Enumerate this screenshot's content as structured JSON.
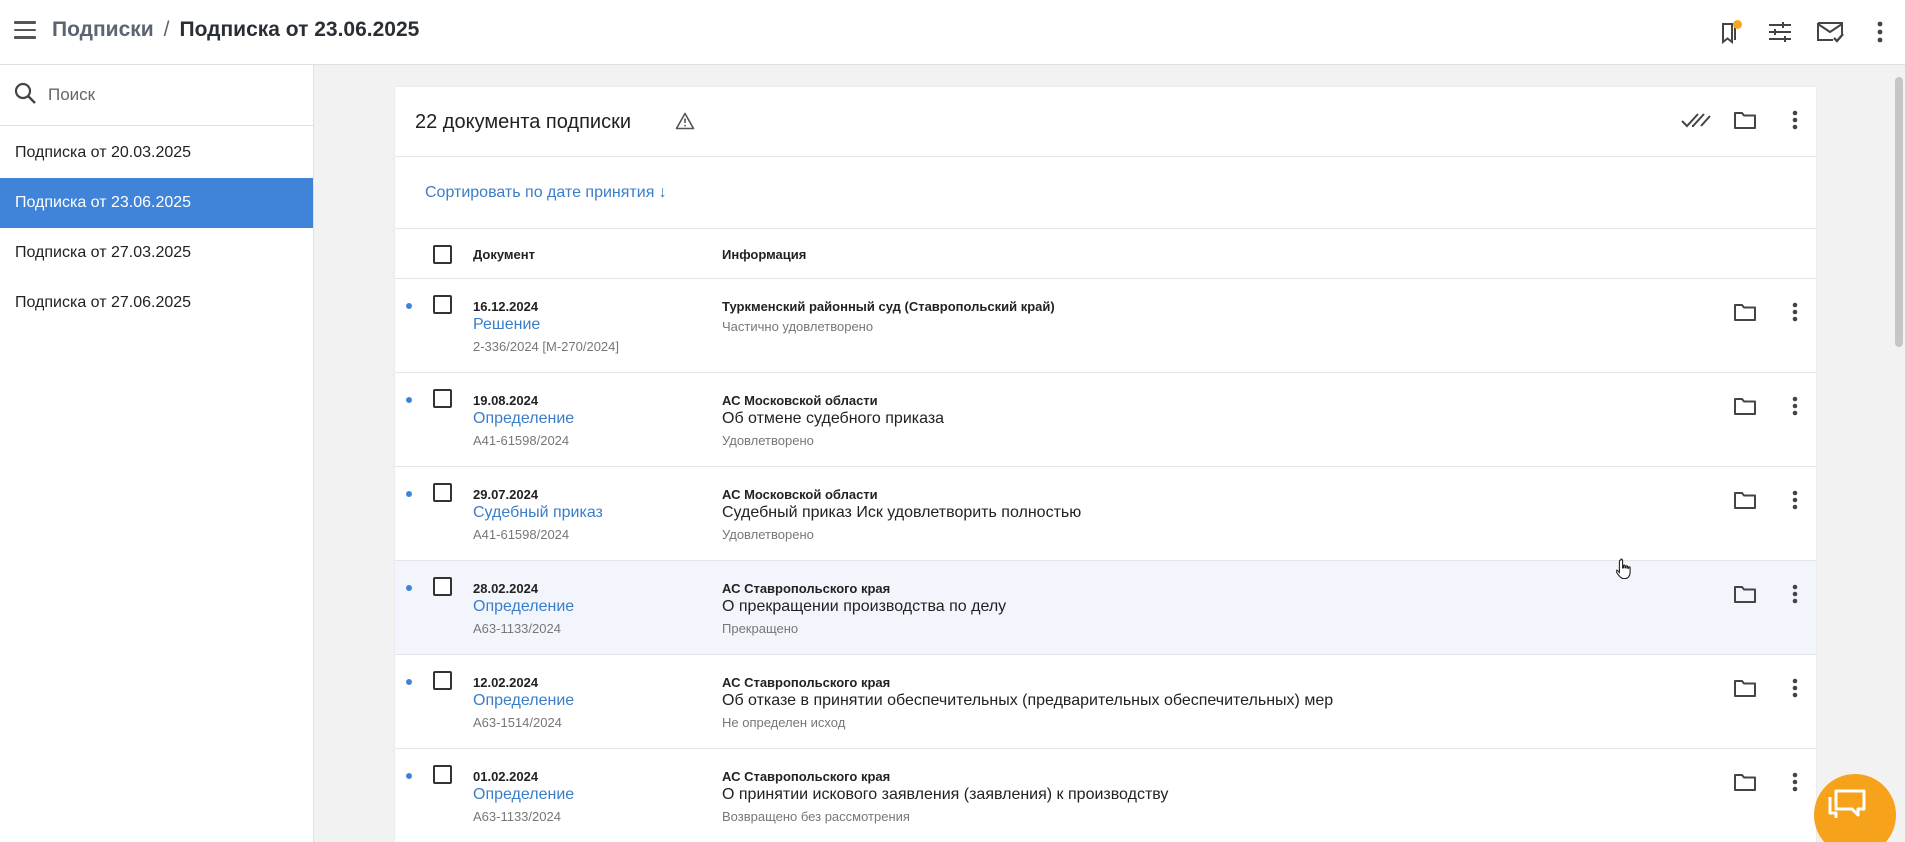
{
  "topbar": {
    "breadcrumb_parent": "Подписки",
    "breadcrumb_separator": "/",
    "breadcrumb_current": "Подписка от 23.06.2025",
    "icons": [
      "bookmarks-icon",
      "filters-icon",
      "mail-check-icon",
      "more-vert-icon"
    ],
    "badge_color": "#f5a623"
  },
  "sidebar": {
    "search_placeholder": "Поиск",
    "items": [
      {
        "label": "Подписка от 20.03.2025",
        "active": false
      },
      {
        "label": "Подписка от 23.06.2025",
        "active": true
      },
      {
        "label": "Подписка от 27.03.2025",
        "active": false
      },
      {
        "label": "Подписка от 27.06.2025",
        "active": false
      }
    ]
  },
  "main": {
    "title": "22 документа подписки",
    "sort_label": "Сортировать по дате принятия ↓",
    "columns": {
      "document": "Документ",
      "info": "Информация"
    },
    "rows": [
      {
        "date": "16.12.2024",
        "type": "Решение",
        "number": "2-336/2024 [М-270/2024]",
        "court": "Туркменский районный суд (Ставропольский край)",
        "description": "",
        "status": "Частично удовлетворено"
      },
      {
        "date": "19.08.2024",
        "type": "Определение",
        "number": "А41-61598/2024",
        "court": "АС Московской области",
        "description": "Об отмене судебного приказа",
        "status": "Удовлетворено"
      },
      {
        "date": "29.07.2024",
        "type": "Судебный приказ",
        "number": "А41-61598/2024",
        "court": "АС Московской области",
        "description": "Судебный приказ Иск удовлетворить полностью",
        "status": "Удовлетворено"
      },
      {
        "date": "28.02.2024",
        "type": "Определение",
        "number": "А63-1133/2024",
        "court": "АС Ставропольского края",
        "description": "О прекращении производства по делу",
        "status": "Прекращено"
      },
      {
        "date": "12.02.2024",
        "type": "Определение",
        "number": "А63-1514/2024",
        "court": "АС Ставропольского края",
        "description": "Об отказе в принятии обеспечительных (предварительных обеспечительных) мер",
        "status": "Не определен исход"
      },
      {
        "date": "01.02.2024",
        "type": "Определение",
        "number": "А63-1133/2024",
        "court": "АС Ставропольского края",
        "description": "О принятии искового заявления (заявления) к производству",
        "status": "Возвращено без рассмотрения"
      }
    ]
  },
  "colors": {
    "accent": "#3f84d9",
    "link": "#3a7dc9",
    "fab": "#f7a21b"
  }
}
